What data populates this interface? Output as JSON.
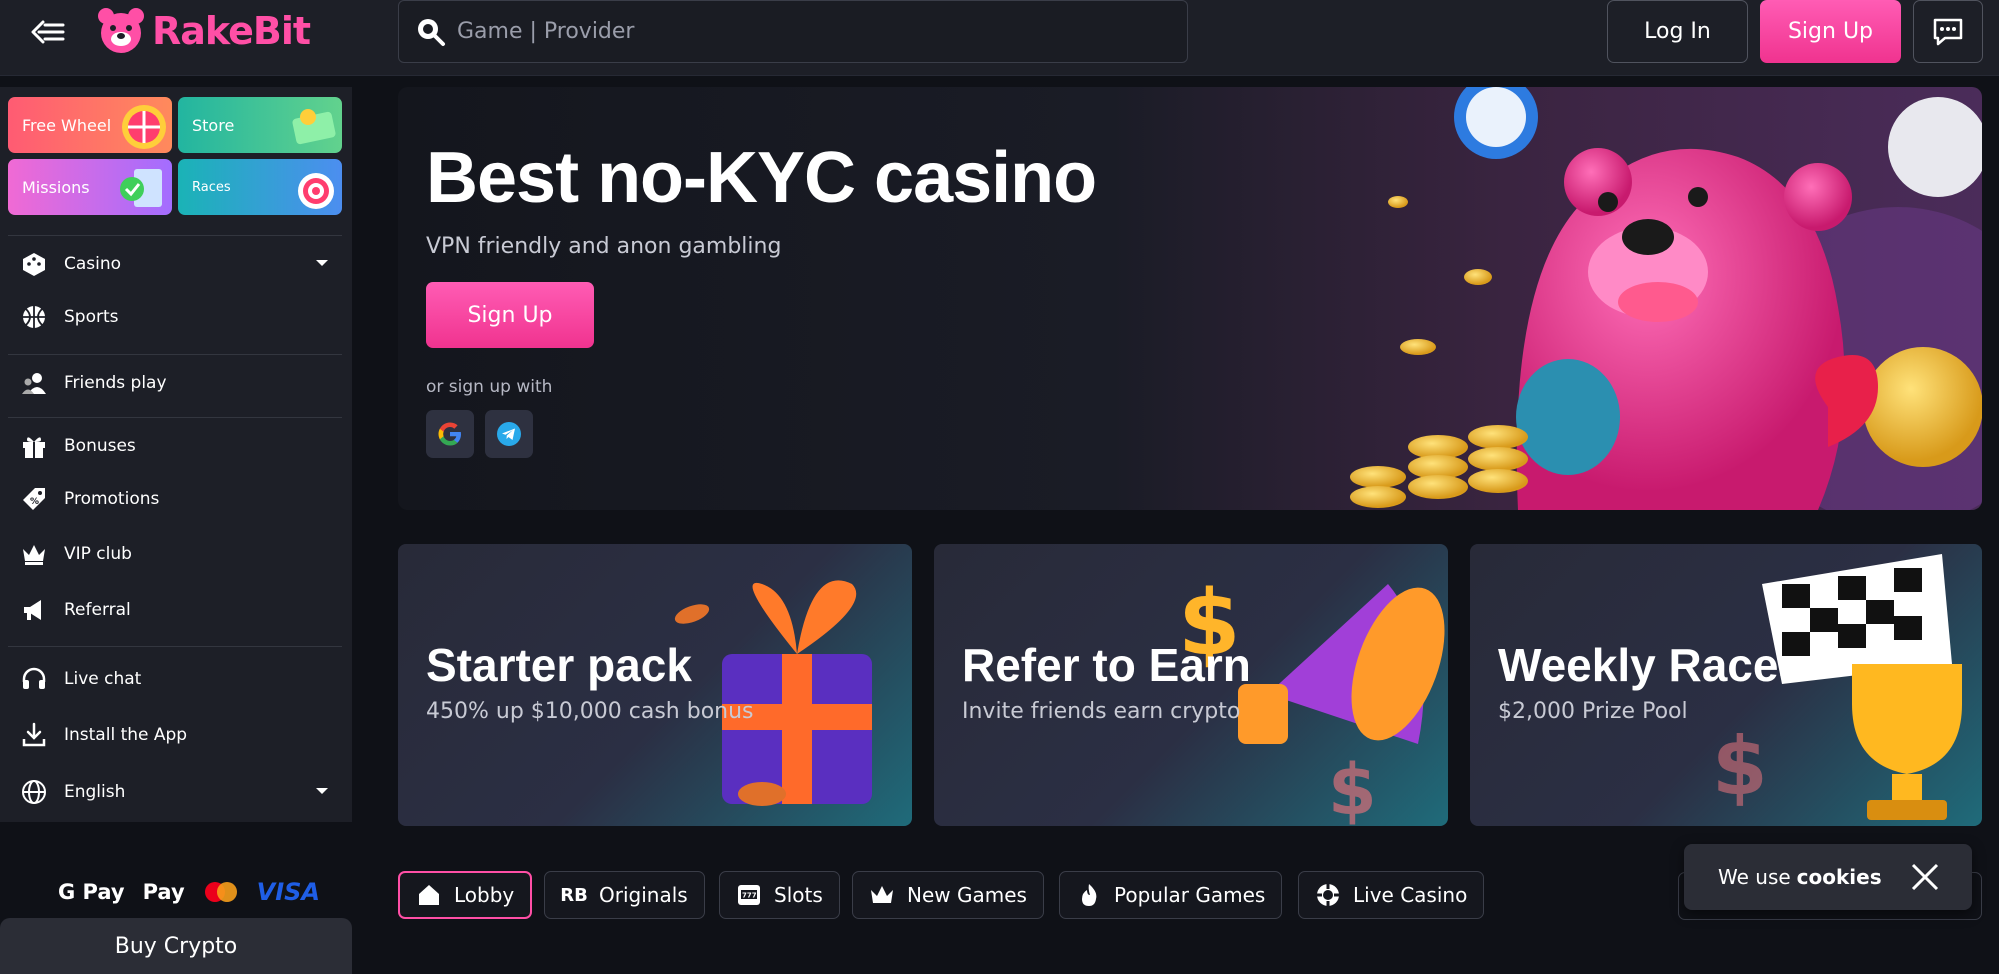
{
  "header": {
    "logo_text": "RakeBit",
    "search_placeholder": "Game | Provider",
    "login_label": "Log In",
    "signup_label": "Sign Up"
  },
  "sidebar": {
    "tiles": [
      {
        "label": "Free Wheel"
      },
      {
        "label": "Store"
      },
      {
        "label": "Missions"
      },
      {
        "label": "Races"
      }
    ],
    "items": [
      {
        "label": "Casino",
        "icon": "dice-icon"
      },
      {
        "label": "Sports",
        "icon": "basketball-icon"
      },
      {
        "label": "Friends play",
        "icon": "users-icon"
      },
      {
        "label": "Bonuses",
        "icon": "gift-icon"
      },
      {
        "label": "Promotions",
        "icon": "tag-icon"
      },
      {
        "label": "VIP club",
        "icon": "crown-icon"
      },
      {
        "label": "Referral",
        "icon": "megaphone-icon"
      },
      {
        "label": "Live chat",
        "icon": "headset-icon"
      },
      {
        "label": "Install the App",
        "icon": "download-icon"
      },
      {
        "label": "English",
        "icon": "globe-icon"
      }
    ],
    "payments": {
      "gpay": "G Pay",
      "apple": "Pay",
      "visa": "VISA"
    },
    "buy_crypto_label": "Buy Crypto"
  },
  "hero": {
    "title": "Best no-KYC casino",
    "subtitle": "VPN friendly and anon gambling",
    "cta_label": "Sign Up",
    "social_text": "or sign up with"
  },
  "promos": [
    {
      "title": "Starter pack",
      "subtitle": "450% up $10,000 cash bonus"
    },
    {
      "title": "Refer to Earn",
      "subtitle": "Invite friends earn crypto"
    },
    {
      "title": "Weekly Races",
      "subtitle": "$2,000 Prize Pool"
    }
  ],
  "tabs": [
    {
      "label": "Lobby",
      "icon": "home-icon"
    },
    {
      "label": "Originals",
      "icon": "rb-icon",
      "icon_text": "RB"
    },
    {
      "label": "Slots",
      "icon": "slot-machine-icon",
      "icon_text": "777"
    },
    {
      "label": "New Games",
      "icon": "crown-icon"
    },
    {
      "label": "Popular Games",
      "icon": "fire-icon"
    },
    {
      "label": "Live Casino",
      "icon": "chip-icon"
    }
  ],
  "cookie": {
    "text": "We use",
    "bold": "cookies"
  },
  "colors": {
    "accent": "#ff4fa6",
    "bg": "#0f1117",
    "panel": "#1d1f27"
  }
}
